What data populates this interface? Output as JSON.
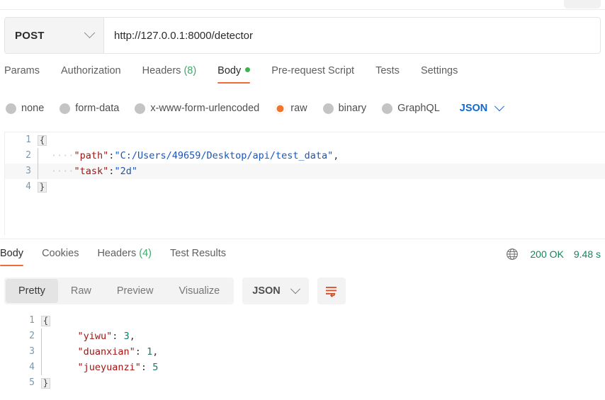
{
  "window": {
    "top_partial_button": ""
  },
  "request": {
    "method": "POST",
    "method_chevron_icon": "chevron-down-icon",
    "url": "http://127.0.0.1:8000/detector",
    "tabs": [
      {
        "label": "Params",
        "count": "",
        "active": false
      },
      {
        "label": "Authorization",
        "count": "",
        "active": false
      },
      {
        "label": "Headers",
        "count": "(8)",
        "active": false
      },
      {
        "label": "Body",
        "count": "",
        "active": true,
        "dot": true
      },
      {
        "label": "Pre-request Script",
        "count": "",
        "active": false
      },
      {
        "label": "Tests",
        "count": "",
        "active": false
      },
      {
        "label": "Settings",
        "count": "",
        "active": false
      }
    ],
    "body_types": [
      {
        "label": "none",
        "selected": false
      },
      {
        "label": "form-data",
        "selected": false
      },
      {
        "label": "x-www-form-urlencoded",
        "selected": false
      },
      {
        "label": "raw",
        "selected": true
      },
      {
        "label": "binary",
        "selected": false
      },
      {
        "label": "GraphQL",
        "selected": false
      }
    ],
    "raw_format": "JSON",
    "raw_format_chevron_icon": "chevron-down-icon",
    "body_editor": {
      "lines": [
        {
          "num": "1",
          "fold": "{",
          "indent": "",
          "text": ""
        },
        {
          "num": "2",
          "fold": "",
          "indent": "····",
          "key": "\"path\"",
          "colon": ":",
          "value": "\"C:/Users/49659/Desktop/api/test_data\"",
          "tail": ","
        },
        {
          "num": "3",
          "fold": "",
          "indent": "····",
          "key": "\"task\"",
          "colon": ":",
          "value": "\"2d\"",
          "tail": ""
        },
        {
          "num": "4",
          "fold": "}",
          "indent": "",
          "text": ""
        }
      ]
    }
  },
  "response": {
    "tabs": [
      {
        "label": "Body",
        "count": "",
        "active": true
      },
      {
        "label": "Cookies",
        "count": "",
        "active": false
      },
      {
        "label": "Headers",
        "count": "(4)",
        "active": false
      },
      {
        "label": "Test Results",
        "count": "",
        "active": false
      }
    ],
    "globe_icon": "globe-icon",
    "status": "200 OK",
    "time": "9.48 s",
    "view_modes": [
      {
        "label": "Pretty",
        "active": true
      },
      {
        "label": "Raw",
        "active": false
      },
      {
        "label": "Preview",
        "active": false
      },
      {
        "label": "Visualize",
        "active": false
      }
    ],
    "format": "JSON",
    "format_chevron_icon": "chevron-down-icon",
    "wrap_icon": "wrap-lines-icon",
    "body_editor": {
      "lines": [
        {
          "num": "1",
          "fold": "{",
          "indent": "",
          "key": "",
          "colon": "",
          "value": "",
          "tail": ""
        },
        {
          "num": "2",
          "fold": "",
          "indent": "    ",
          "key": "\"yiwu\"",
          "colon": ": ",
          "value": "3",
          "tail": ","
        },
        {
          "num": "3",
          "fold": "",
          "indent": "    ",
          "key": "\"duanxian\"",
          "colon": ": ",
          "value": "1",
          "tail": ","
        },
        {
          "num": "4",
          "fold": "",
          "indent": "    ",
          "key": "\"jueyuanzi\"",
          "colon": ": ",
          "value": "5",
          "tail": ""
        },
        {
          "num": "5",
          "fold": "}",
          "indent": "",
          "key": "",
          "colon": "",
          "value": "",
          "tail": ""
        }
      ]
    }
  },
  "colors": {
    "accent_orange": "#ef6c36",
    "radio_selected": "#f4742c",
    "status_green": "#12865a",
    "count_green": "#3aab68",
    "json_blue": "#1268d3",
    "json_key": "#a31515",
    "json_string": "#1a56b8",
    "json_number": "#117a68"
  }
}
